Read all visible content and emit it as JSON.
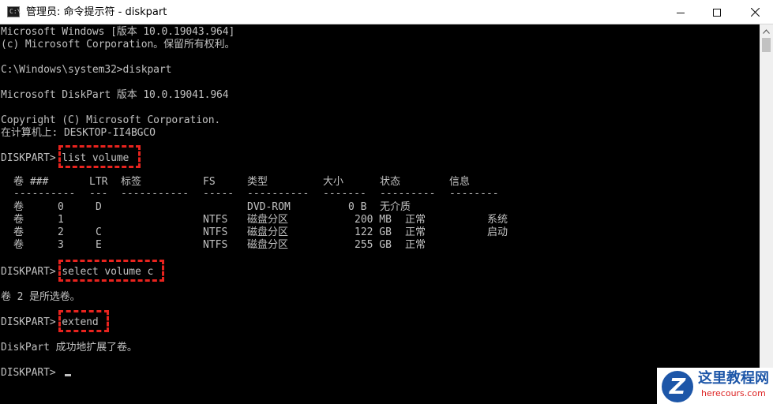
{
  "window": {
    "icon_text": "C:\\",
    "title": "管理员: 命令提示符 - diskpart",
    "min_icon": "minimize-icon",
    "max_icon": "maximize-icon",
    "close_icon": "close-icon"
  },
  "console": {
    "lines": [
      "Microsoft Windows [版本 10.0.19043.964]",
      "(c) Microsoft Corporation。保留所有权利。",
      "C:\\Windows\\system32>diskpart",
      "Microsoft DiskPart 版本 10.0.19041.964",
      "Copyright (C) Microsoft Corporation.",
      "在计算机上: DESKTOP-II4BGCO",
      "DISKPART> list volume",
      "DISKPART> select volume c",
      "卷 2 是所选卷。",
      "DISKPART> extend",
      "DiskPart 成功地扩展了卷。",
      "DISKPART> "
    ],
    "volume_table": {
      "headers": [
        "卷 ###",
        "LTR",
        "标签",
        "FS",
        "类型",
        "大小",
        "状态",
        "信息"
      ],
      "separator": [
        "----------",
        "---",
        "-----------",
        "-----",
        "----------",
        "-------",
        "---------",
        "--------"
      ],
      "rows": [
        [
          "卷",
          "0",
          "D",
          "",
          "",
          "DVD-ROM",
          "0 B",
          "无介质",
          ""
        ],
        [
          "卷",
          "1",
          "",
          "",
          "NTFS",
          "磁盘分区",
          "200 MB",
          "正常",
          "系统"
        ],
        [
          "卷",
          "2",
          "C",
          "",
          "NTFS",
          "磁盘分区",
          "122 GB",
          "正常",
          "启动"
        ],
        [
          "卷",
          "3",
          "E",
          "",
          "NTFS",
          "磁盘分区",
          "255 GB",
          "正常",
          ""
        ]
      ]
    },
    "highlight_color": "#e8231e"
  },
  "watermark": {
    "logo_letter": "Z",
    "name": "这里教程网",
    "url": "herecours.com"
  }
}
